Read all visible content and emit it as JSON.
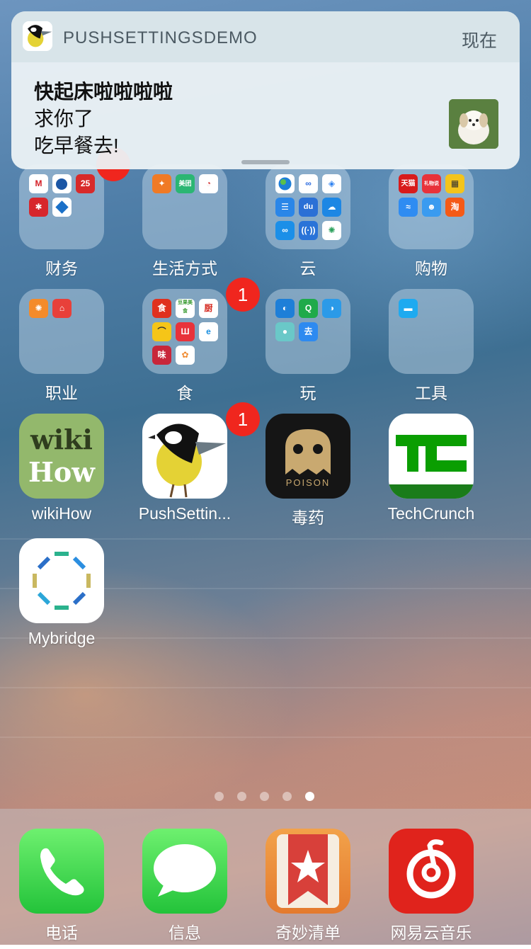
{
  "notification": {
    "app_name": "PUSHSETTINGSDEMO",
    "time": "现在",
    "title": "快起床啦啦啦啦",
    "line2": "求你了",
    "line3": "吃早餐去!"
  },
  "folders": [
    {
      "label": "财务",
      "badge": ""
    },
    {
      "label": "生活方式",
      "badge": ""
    },
    {
      "label": "云",
      "badge": ""
    },
    {
      "label": "购物",
      "badge": ""
    },
    {
      "label": "职业",
      "badge": ""
    },
    {
      "label": "食",
      "badge": "1"
    },
    {
      "label": "玩",
      "badge": ""
    },
    {
      "label": "工具",
      "badge": ""
    }
  ],
  "apps": [
    {
      "label": "wikiHow",
      "icon_top": "wiki",
      "icon_bottom": "How"
    },
    {
      "label": "PushSettin...",
      "badge": "1"
    },
    {
      "label": "毒药",
      "icon_text": "POISON"
    },
    {
      "label": "TechCrunch"
    },
    {
      "label": "Mybridge"
    }
  ],
  "page_dots": {
    "count": 5,
    "active": 5
  },
  "dock": [
    {
      "label": "电话"
    },
    {
      "label": "信息"
    },
    {
      "label": "奇妙清单"
    },
    {
      "label": "网易云音乐"
    }
  ],
  "mini_icons": {
    "shopping_tmall": "天猫",
    "shopping_gift": "礼物说",
    "shopping_taobao": "淘",
    "food_shi": "食",
    "food_douguo": "豆果美食",
    "food_chu": "厨",
    "play_qu": "去"
  },
  "colors": {
    "badge": "#f0261e",
    "phone_green": "#3fd74e",
    "netease_red": "#e0231c",
    "wunderlist_red": "#d8403a",
    "poison_gold": "#c9a970"
  }
}
